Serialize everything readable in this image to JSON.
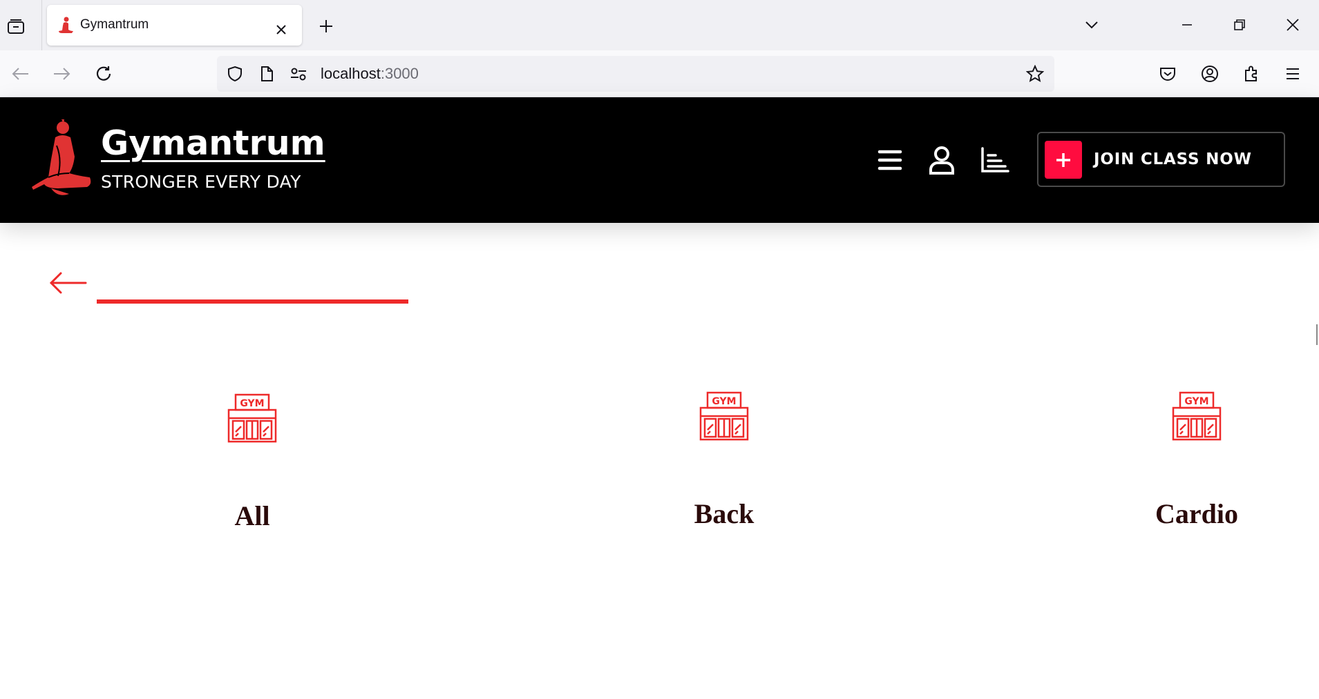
{
  "browser": {
    "tab_title": "Gymantrum",
    "url_host": "localhost",
    "url_port": ":3000"
  },
  "header": {
    "brand_name": "Gymantrum",
    "tagline": "STRONGER EVERY DAY",
    "join_button_label": "JOIN CLASS NOW",
    "accent_color": "#ff0c3f"
  },
  "categories": [
    {
      "label": "All",
      "icon": "gym-building-icon"
    },
    {
      "label": "Back",
      "icon": "gym-building-icon"
    },
    {
      "label": "Cardio",
      "icon": "gym-building-icon"
    }
  ],
  "colors": {
    "header_bg": "#000000",
    "accent_red": "#ee2a2a",
    "category_text": "#2a0a0a"
  }
}
